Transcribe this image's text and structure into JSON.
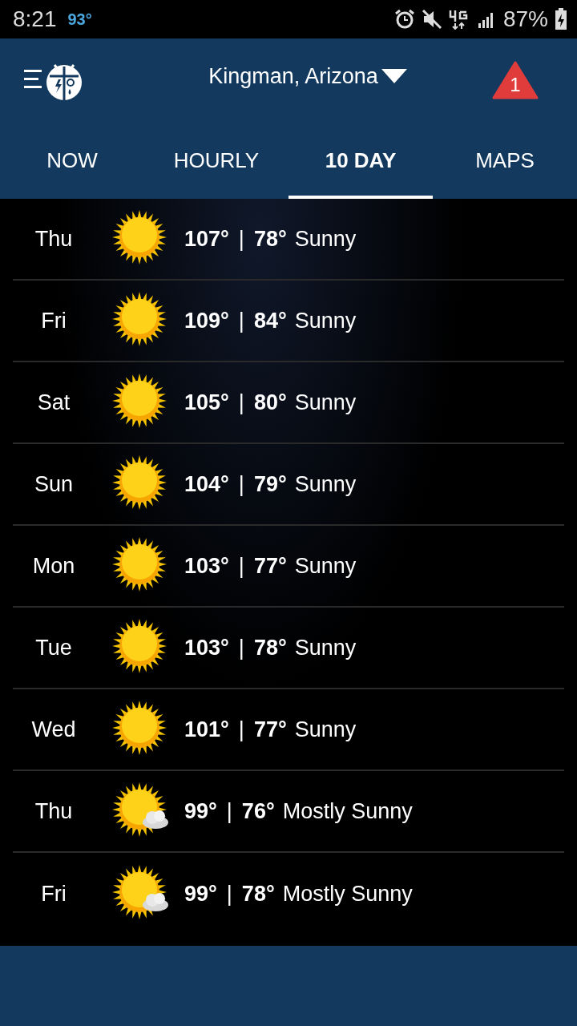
{
  "status_bar": {
    "time": "8:21",
    "temperature": "93°",
    "battery": "87%"
  },
  "header": {
    "location": "Kingman, Arizona",
    "alert_count": "1"
  },
  "tabs": [
    {
      "label": "NOW",
      "selected": false
    },
    {
      "label": "HOURLY",
      "selected": false
    },
    {
      "label": "10 DAY",
      "selected": true
    },
    {
      "label": "MAPS",
      "selected": false
    }
  ],
  "forecast": [
    {
      "day": "Thu",
      "kind": "sunny",
      "high": "107°",
      "separator": "|",
      "low": "78°",
      "condition": "Sunny"
    },
    {
      "day": "Fri",
      "kind": "sunny",
      "high": "109°",
      "separator": "|",
      "low": "84°",
      "condition": "Sunny"
    },
    {
      "day": "Sat",
      "kind": "sunny",
      "high": "105°",
      "separator": "|",
      "low": "80°",
      "condition": "Sunny"
    },
    {
      "day": "Sun",
      "kind": "sunny",
      "high": "104°",
      "separator": "|",
      "low": "79°",
      "condition": "Sunny"
    },
    {
      "day": "Mon",
      "kind": "sunny",
      "high": "103°",
      "separator": "|",
      "low": "77°",
      "condition": "Sunny"
    },
    {
      "day": "Tue",
      "kind": "sunny",
      "high": "103°",
      "separator": "|",
      "low": "78°",
      "condition": "Sunny"
    },
    {
      "day": "Wed",
      "kind": "sunny",
      "high": "101°",
      "separator": "|",
      "low": "77°",
      "condition": "Sunny"
    },
    {
      "day": "Thu",
      "kind": "mostly_sunny",
      "high": "99°",
      "separator": "|",
      "low": "76°",
      "condition": "Mostly Sunny"
    },
    {
      "day": "Fri",
      "kind": "mostly_sunny",
      "high": "99°",
      "separator": "|",
      "low": "78°",
      "condition": "Mostly Sunny"
    }
  ]
}
